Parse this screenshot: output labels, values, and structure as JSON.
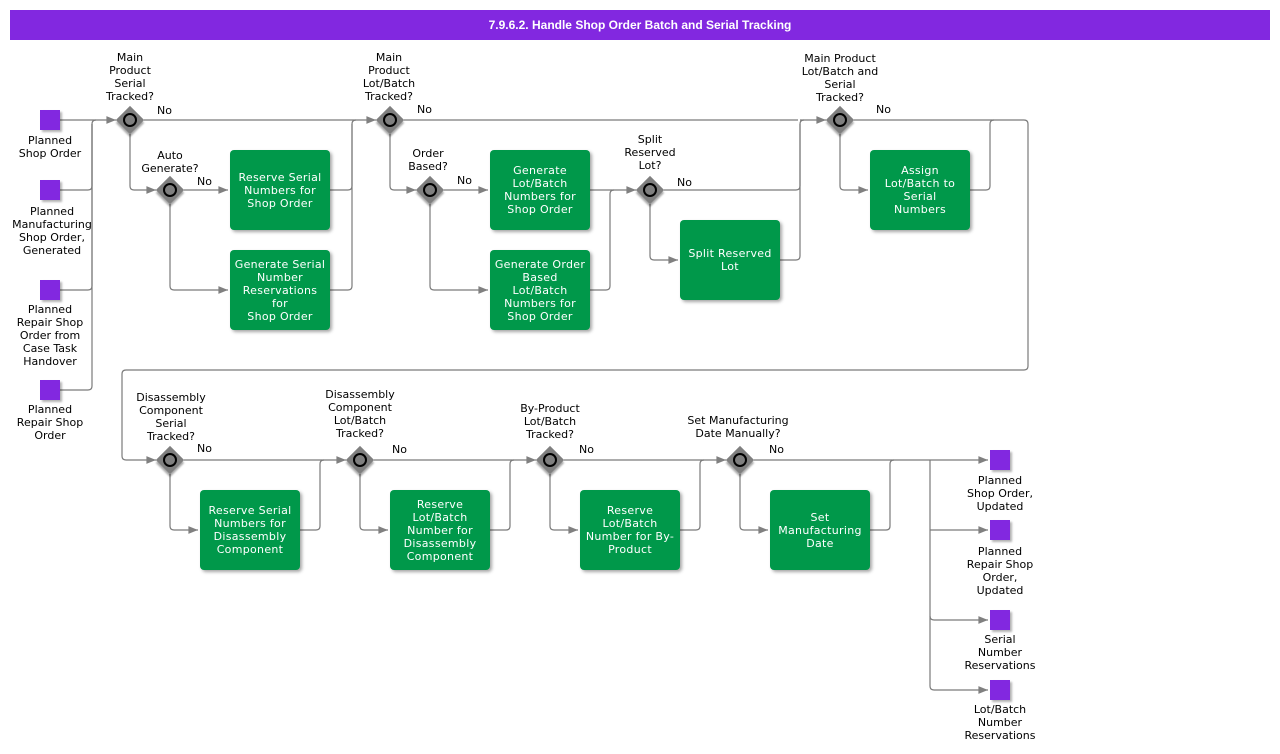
{
  "title": "7.9.6.2. Handle Shop Order Batch and Serial Tracking",
  "colors": {
    "title_bar": "#8228E0",
    "task": "#00984A",
    "event": "#8228E0",
    "gateway": "#7F7F7F"
  },
  "start_events": [
    {
      "label": "Planned\nShop Order"
    },
    {
      "label": "Planned\nManufacturing\nShop Order,\nGenerated"
    },
    {
      "label": "Planned\nRepair Shop\nOrder from\nCase Task\nHandover"
    },
    {
      "label": "Planned\nRepair Shop\nOrder"
    }
  ],
  "gateways": [
    {
      "id": "g1",
      "label": "Main\nProduct\nSerial\nTracked?",
      "no": "No"
    },
    {
      "id": "g2",
      "label": "Auto\nGenerate?",
      "no": "No"
    },
    {
      "id": "g3",
      "label": "Main\nProduct\nLot/Batch\nTracked?",
      "no": "No"
    },
    {
      "id": "g4",
      "label": "Order\nBased?",
      "no": "No"
    },
    {
      "id": "g5",
      "label": "Split\nReserved\nLot?",
      "no": "No"
    },
    {
      "id": "g6",
      "label": "Main Product\nLot/Batch and\nSerial\nTracked?",
      "no": "No"
    },
    {
      "id": "g7",
      "label": "Disassembly\nComponent\nSerial\nTracked?",
      "no": "No"
    },
    {
      "id": "g8",
      "label": "Disassembly\nComponent\nLot/Batch\nTracked?",
      "no": "No"
    },
    {
      "id": "g9",
      "label": "By-Product\nLot/Batch\nTracked?",
      "no": "No"
    },
    {
      "id": "g10",
      "label": "Set Manufacturing\nDate Manually?",
      "no": "No"
    }
  ],
  "tasks": [
    {
      "id": "t1",
      "label": "Reserve Serial\nNumbers for\nShop Order"
    },
    {
      "id": "t2",
      "label": "Generate Serial\nNumber\nReservations for\nShop Order"
    },
    {
      "id": "t3",
      "label": "Generate\nLot/Batch\nNumbers for\nShop Order"
    },
    {
      "id": "t4",
      "label": "Generate Order\nBased Lot/Batch\nNumbers for\nShop Order"
    },
    {
      "id": "t5",
      "label": "Split Reserved\nLot"
    },
    {
      "id": "t6",
      "label": "Assign\nLot/Batch to\nSerial\nNumbers"
    },
    {
      "id": "t7",
      "label": "Reserve Serial\nNumbers for\nDisassembly\nComponent"
    },
    {
      "id": "t8",
      "label": "Reserve\nLot/Batch\nNumber for\nDisassembly\nComponent"
    },
    {
      "id": "t9",
      "label": "Reserve\nLot/Batch\nNumber for By-\nProduct"
    },
    {
      "id": "t10",
      "label": "Set\nManufacturing\nDate"
    }
  ],
  "end_events": [
    {
      "label": "Planned\nShop Order,\nUpdated"
    },
    {
      "label": "Planned\nRepair Shop\nOrder,\nUpdated"
    },
    {
      "label": "Serial\nNumber\nReservations"
    },
    {
      "label": "Lot/Batch\nNumber\nReservations"
    }
  ]
}
